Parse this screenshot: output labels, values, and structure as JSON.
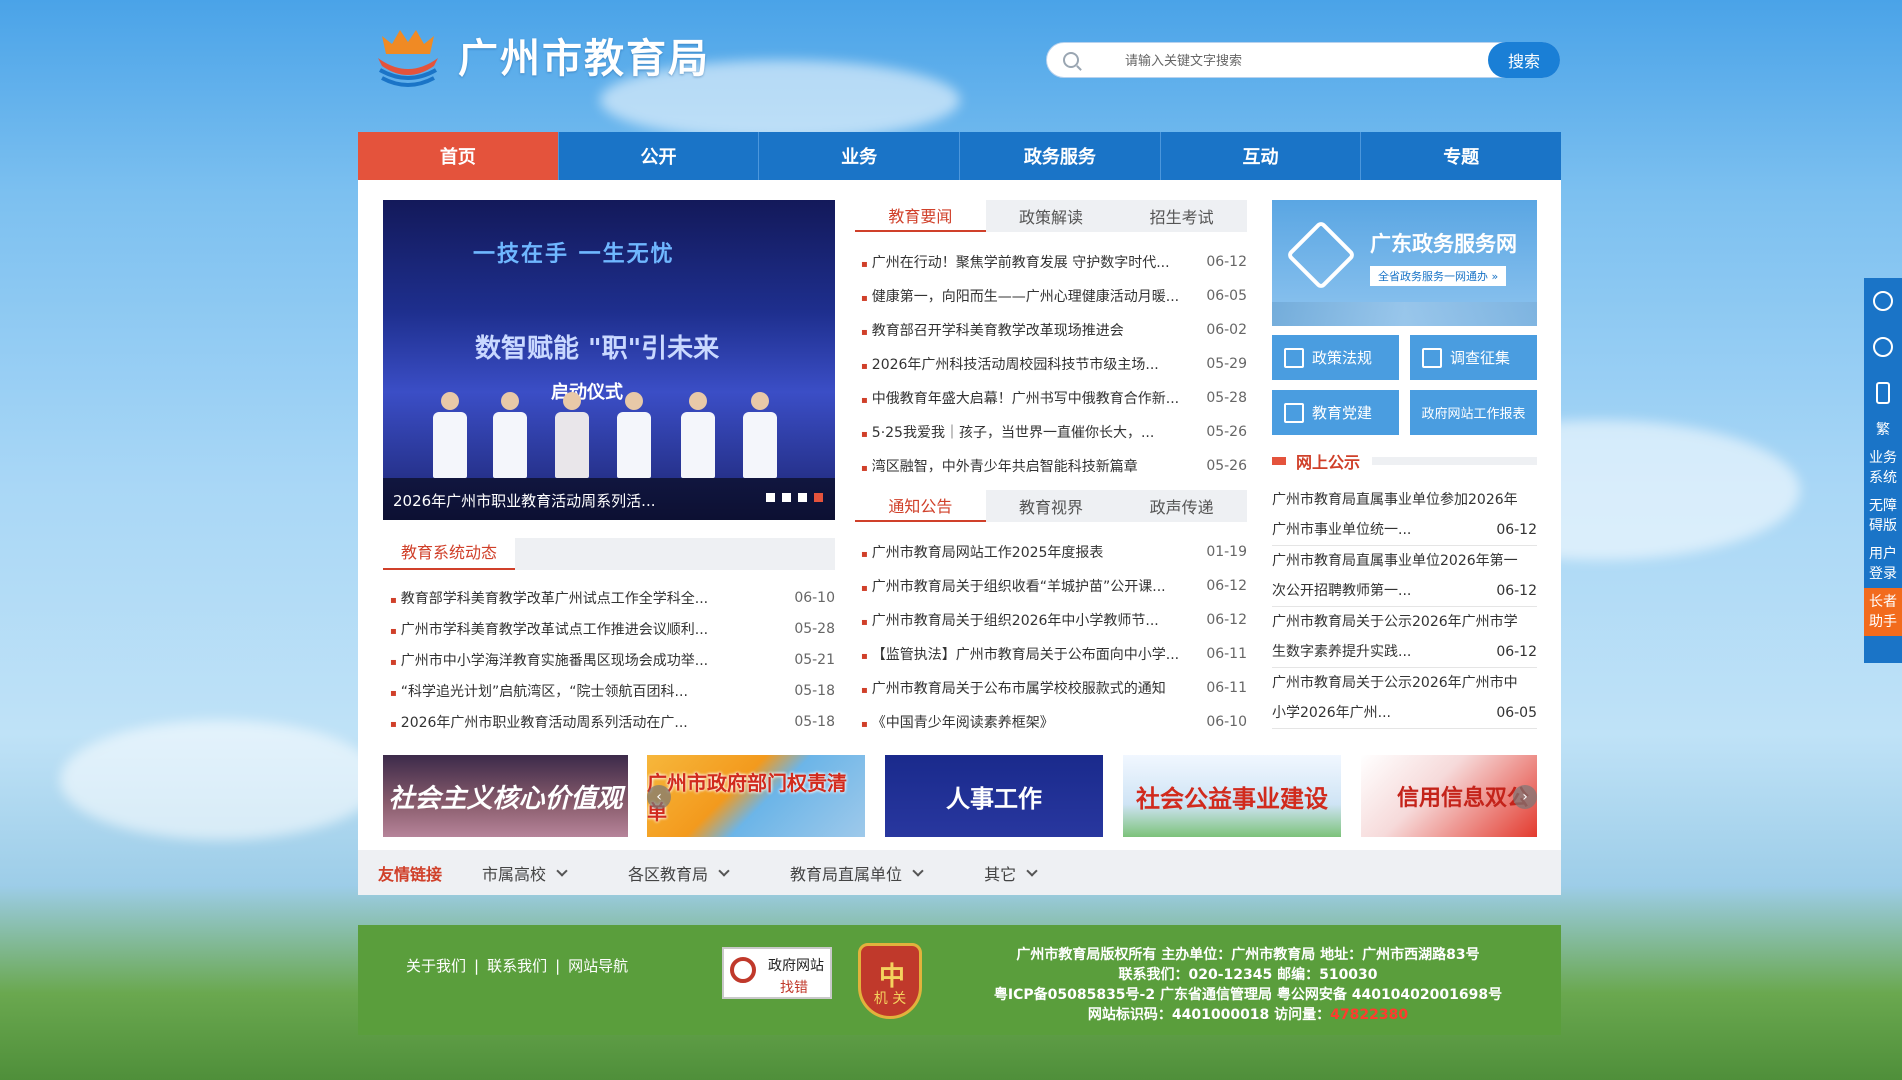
{
  "header": {
    "site_title": "广州市教育局",
    "search_placeholder": "请输入关键文字搜索",
    "search_button": "搜索"
  },
  "nav": [
    {
      "label": "首页",
      "active": true
    },
    {
      "label": "公开"
    },
    {
      "label": "业务"
    },
    {
      "label": "政务服务"
    },
    {
      "label": "互动"
    },
    {
      "label": "专题"
    }
  ],
  "slider": {
    "stage_line1": "一技在手  一生无忧",
    "stage_line2": "数智赋能 \"职\"引未来",
    "stage_line3": "启动仪式",
    "caption": "2026年广州市职业教育活动周系列活...",
    "slides": 4,
    "active_slide": 4
  },
  "news_tabs": [
    "教育要闻",
    "政策解读",
    "招生考试"
  ],
  "news": [
    {
      "title": "广州在行动！聚焦学前教育发展 守护数字时代...",
      "date": "06-12"
    },
    {
      "title": "健康第一，向阳而生——广州心理健康活动月暖...",
      "date": "06-05"
    },
    {
      "title": "教育部召开学科美育教学改革现场推进会",
      "date": "06-02"
    },
    {
      "title": "2026年广州科技活动周校园科技节市级主场...",
      "date": "05-29"
    },
    {
      "title": "中俄教育年盛大启幕！广州书写中俄教育合作新...",
      "date": "05-28"
    },
    {
      "title": "5·25我爱我｜孩子，当世界一直催你长大，...",
      "date": "05-26"
    },
    {
      "title": "湾区融智，中外青少年共启智能科技新篇章",
      "date": "05-26"
    }
  ],
  "notice_tabs": [
    "通知公告",
    "教育视界",
    "政声传递"
  ],
  "notices": [
    {
      "title": "广州市教育局网站工作2025年度报表",
      "date": "01-19"
    },
    {
      "title": "广州市教育局关于组织收看“羊城护苗”公开课...",
      "date": "06-12"
    },
    {
      "title": "广州市教育局关于组织2026年中小学教师节...",
      "date": "06-12"
    },
    {
      "title": "【监管执法】广州市教育局关于公布面向中小学...",
      "date": "06-11"
    },
    {
      "title": "广州市教育局关于公布市属学校校服款式的通知",
      "date": "06-11"
    },
    {
      "title": "《中国青少年阅读素养框架》",
      "date": "06-10"
    }
  ],
  "system_news_title": "教育系统动态",
  "system_news": [
    {
      "title": "教育部学科美育教学改革广州试点工作全学科全...",
      "date": "06-10"
    },
    {
      "title": "广州市学科美育教学改革试点工作推进会议顺利...",
      "date": "05-28"
    },
    {
      "title": "广州市中小学海洋教育实施番禺区现场会成功举...",
      "date": "05-21"
    },
    {
      "title": "“科学追光计划”启航湾区，“院士领航百团科...",
      "date": "05-18"
    },
    {
      "title": "2026年广州市职业教育活动周系列活动在广...",
      "date": "05-18"
    }
  ],
  "gd_banner": {
    "title": "广东政务服务网",
    "sub": "全省政务服务一网通办 »"
  },
  "quick_buttons": [
    "政策法规",
    "调查征集",
    "教育党建",
    "政府网站工作报表"
  ],
  "public_notice": {
    "title": "网上公示",
    "items": [
      {
        "line1": "广州市教育局直属事业单位参加2026年",
        "line2": "广州市事业单位统一...",
        "date": "06-12"
      },
      {
        "line1": "广州市教育局直属事业单位2026年第一",
        "line2": "次公开招聘教师第一...",
        "date": "06-12"
      },
      {
        "line1": "广州市教育局关于公示2026年广州市学",
        "line2": "生数字素养提升实践...",
        "date": "06-12"
      },
      {
        "line1": "广州市教育局关于公示2026年广州市中",
        "line2": "小学2026年广州...",
        "date": "06-05"
      }
    ]
  },
  "banners": [
    "社会主义核心价值观",
    "广州市政府部门权责清单",
    "人事工作",
    "社会公益事业建设",
    "信用信息双公"
  ],
  "links": {
    "title": "友情链接",
    "items": [
      "市属高校",
      "各区教育局",
      "教育局直属单位",
      "其它"
    ]
  },
  "footer": {
    "links": [
      "关于我们",
      "联系我们",
      "网站导航"
    ],
    "badge_line1": "政府网站",
    "badge_line2": "找错",
    "seal_text": "机 关",
    "line1": "广州市教育局版权所有 主办单位：广州市教育局 地址：广州市西湖路83号",
    "line2": "联系我们：020-12345 邮编：510030",
    "line3": "粤ICP备05085835号-2 广东省通信管理局  粤公网安备 44010402001698号",
    "line4_prefix": "网站标识码：4401000018 访问量：",
    "visits": "47822380"
  },
  "side": {
    "items": [
      "繁",
      "业务系统",
      "无障碍版",
      "用户登录",
      "长者助手"
    ]
  },
  "colors": {
    "nav_blue": "#1a74c7",
    "active_red": "#e4533c",
    "footer_green": "#5a9e3c"
  }
}
